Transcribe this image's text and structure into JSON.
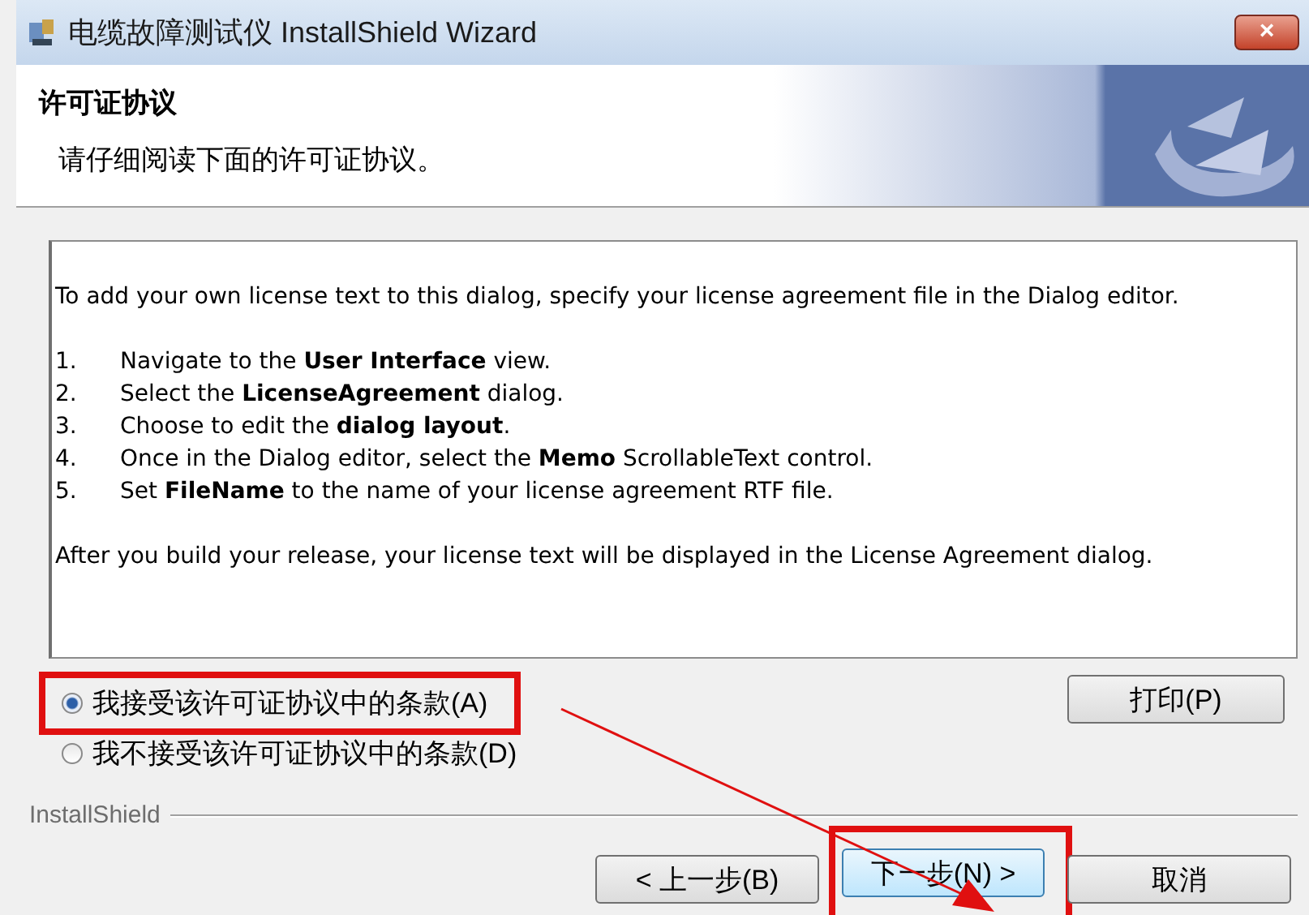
{
  "window": {
    "title": "电缆故障测试仪 InstallShield Wizard",
    "close": "×"
  },
  "header": {
    "title": "许可证协议",
    "subtitle": "请仔细阅读下面的许可证协议。"
  },
  "license": {
    "intro": "To add your own license text to this dialog, specify your license agreement file in the Dialog editor.",
    "steps": [
      {
        "number": "1.",
        "text": "Navigate to the **User Interface** view."
      },
      {
        "number": "2.",
        "text": "Select the **LicenseAgreement** dialog."
      },
      {
        "number": "3.",
        "text": "Choose to edit the **dialog layout**."
      },
      {
        "number": "4.",
        "text": "Once in the Dialog editor, select the **Memo** ScrollableText control."
      },
      {
        "number": "5.",
        "text": "Set **FileName** to the name of your license agreement RTF file."
      }
    ],
    "outro": "After you build your release, your license text will be displayed in the License Agreement dialog."
  },
  "options": [
    {
      "label": "我接受该许可证协议中的条款(A)",
      "selected": true,
      "annotated": true
    },
    {
      "label": "我不接受该许可证协议中的条款(D)",
      "selected": false,
      "annotated": false
    }
  ],
  "print_button": "打印(P)",
  "brand": "InstallShield",
  "buttons": [
    {
      "label": "< 上一步(B)",
      "kind": "back",
      "annotated": false
    },
    {
      "label": "下一步(N) >",
      "kind": "next",
      "annotated": true
    },
    {
      "label": "取消",
      "kind": "cancel",
      "annotated": false
    }
  ]
}
